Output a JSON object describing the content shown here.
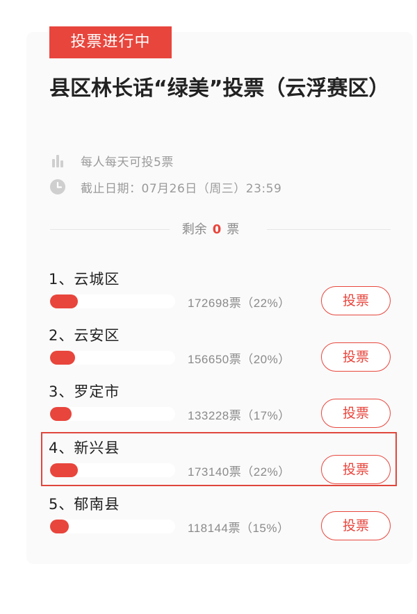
{
  "status_badge": "投票进行中",
  "title": "县区林长话“绿美”投票（云浮赛区）",
  "rules": {
    "daily_limit": "每人每天可投5票",
    "deadline": "截止日期：07月26日（周三）23:59"
  },
  "remaining": {
    "prefix": "剩余",
    "count": "0",
    "suffix": "票"
  },
  "vote_button_label": "投票",
  "colors": {
    "accent": "#e8453c",
    "highlight_border": "#e0463c"
  },
  "candidates": [
    {
      "label": "1、云城区",
      "stats": "172698票（22%）",
      "percent": 22
    },
    {
      "label": "2、云安区",
      "stats": "156650票（20%）",
      "percent": 20
    },
    {
      "label": "3、罗定市",
      "stats": "133228票（17%）",
      "percent": 17
    },
    {
      "label": "4、新兴县",
      "stats": "173140票（22%）",
      "percent": 22,
      "highlighted": true
    },
    {
      "label": "5、郁南县",
      "stats": "118144票（15%）",
      "percent": 15
    }
  ]
}
